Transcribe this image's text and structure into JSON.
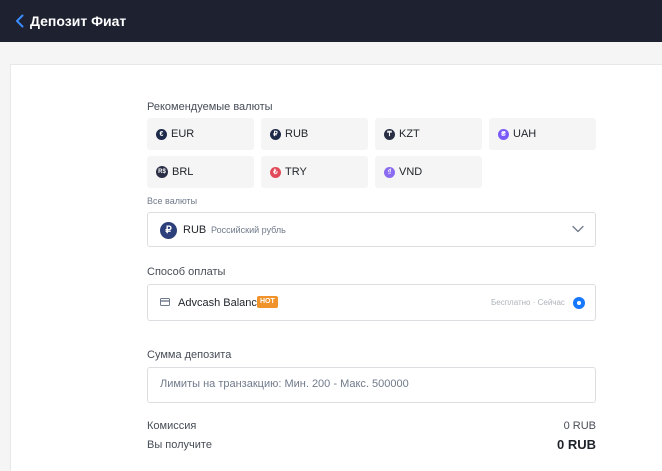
{
  "header": {
    "title": "Депозит Фиат",
    "back_icon": "chevron-left-icon"
  },
  "recommended": {
    "label": "Рекомендуемые валюты",
    "currencies": [
      {
        "code": "EUR",
        "symbol": "€",
        "color": "#1e2a4a"
      },
      {
        "code": "RUB",
        "symbol": "₽",
        "color": "#1e2a4a"
      },
      {
        "code": "KZT",
        "symbol": "₸",
        "color": "#2a2f45"
      },
      {
        "code": "UAH",
        "symbol": "₴",
        "color": "#7a5af8"
      },
      {
        "code": "BRL",
        "symbol": "R$",
        "color": "#2a2f45"
      },
      {
        "code": "TRY",
        "symbol": "₺",
        "color": "#e24a5a"
      },
      {
        "code": "VND",
        "symbol": "₫",
        "color": "#8b6cf0"
      }
    ]
  },
  "all_currencies": {
    "label": "Все валюты",
    "selected_code": "RUB",
    "selected_name": "Российский рубль",
    "selected_symbol": "₽"
  },
  "payment": {
    "label": "Способ оплаты",
    "method_name": "Advcash Balance",
    "badge": "HOT",
    "meta": "Бесплатно · Сейчас",
    "icon": "card-icon"
  },
  "deposit": {
    "label": "Сумма депозита",
    "placeholder": "Лимиты на транзакцию: Мин. 200 - Макс. 500000"
  },
  "summary": {
    "fee_label": "Комиссия",
    "fee_value": "0 RUB",
    "receive_label": "Вы получите",
    "receive_value": "0 RUB"
  },
  "colors": {
    "topbar": "#1e2130",
    "accent": "#1677ff",
    "hot_badge": "#f0932b"
  }
}
